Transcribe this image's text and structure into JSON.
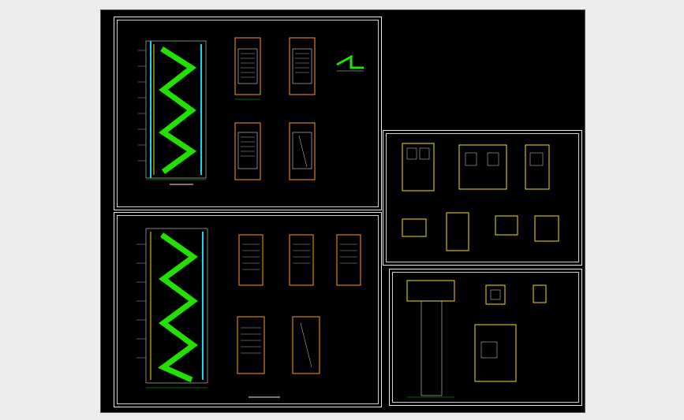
{
  "viewer": {
    "background": "#ececec",
    "canvas_background": "#000000"
  },
  "palette": {
    "frame": "#e8e8e8",
    "wall_yellow": "#f0e000",
    "wall_orange": "#ff9a1a",
    "stair_green": "#22e000",
    "glass_cyan": "#18d8f0",
    "dim_green": "#10c810",
    "line_white": "#d8d8d8",
    "text_white": "#f0f0f0"
  },
  "sheets": [
    {
      "id": "sheet-1-stair-section",
      "drawings": 6
    },
    {
      "id": "sheet-2-stair-section",
      "drawings": 6
    },
    {
      "id": "sheet-3-toilet-details",
      "drawings": 9
    },
    {
      "id": "sheet-4-shaft-details",
      "drawings": 4
    }
  ],
  "icons": {
    "north": "north-arrow-icon"
  }
}
